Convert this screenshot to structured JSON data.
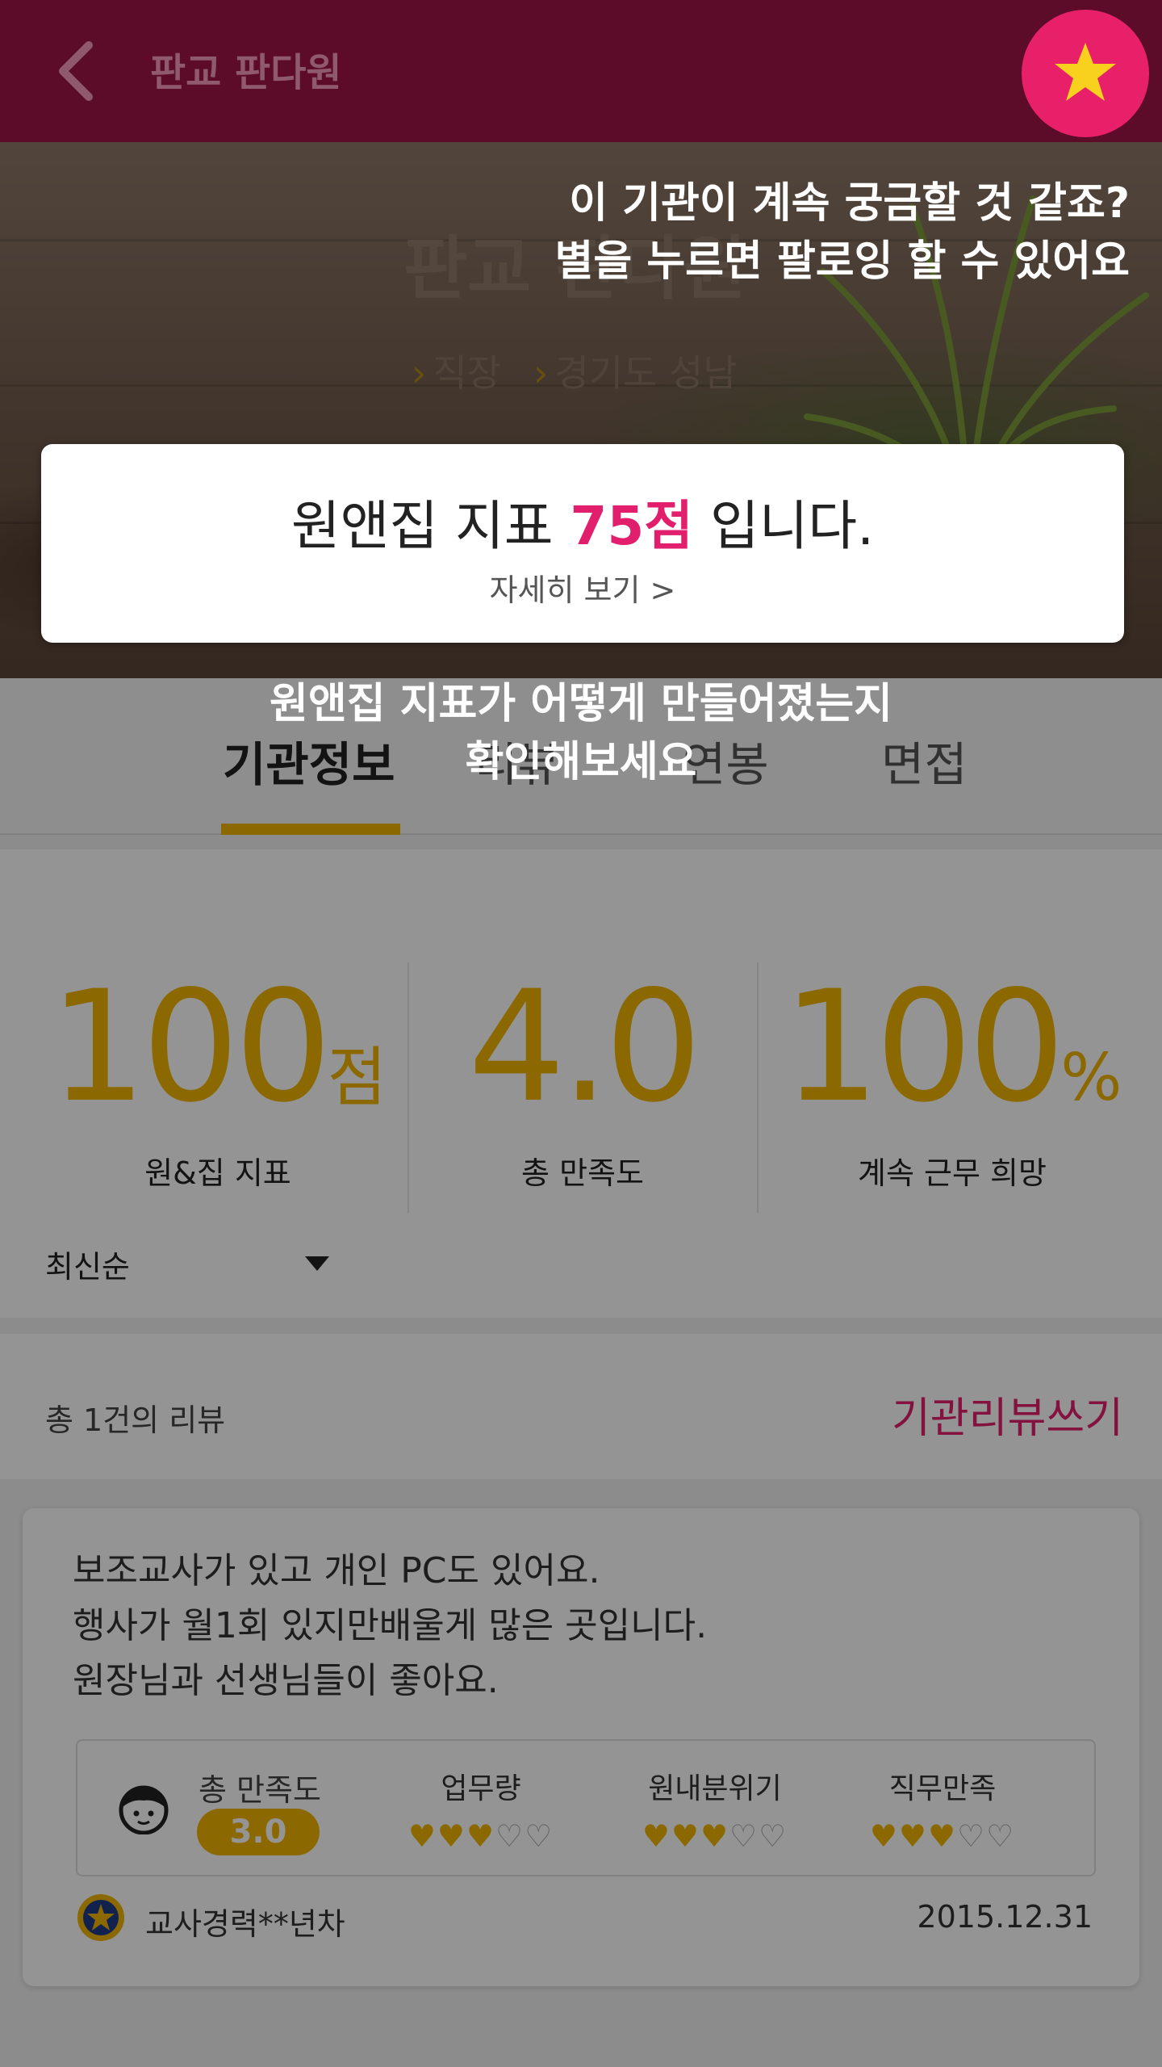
{
  "appbar": {
    "title": "판교 판다원"
  },
  "hero": {
    "title": "판교 판다원",
    "tags": [
      "직장",
      "경기도 성남"
    ]
  },
  "score_card": {
    "prefix": "원앤집 지표 ",
    "score": "75점",
    "suffix": " 입니다.",
    "link": "자세히 보기 >"
  },
  "tabs": [
    "기관정보",
    "리뷰",
    "연봉",
    "면접"
  ],
  "stats": [
    {
      "value": "100",
      "unit": "점",
      "label": "원&집 지표"
    },
    {
      "value": "4.0",
      "unit": "",
      "label": "총 만족도"
    },
    {
      "value": "100",
      "unit": "%",
      "label": "계속 근무 희망"
    }
  ],
  "sort": {
    "label": "최신순"
  },
  "reviews_header": {
    "count": "총 1건의 리뷰",
    "write": "기관리뷰쓰기"
  },
  "review": {
    "lines": [
      "보조교사가 있고 개인 PC도 있어요.",
      "행사가 월1회 있지만배울게 많은 곳입니다.",
      "원장님과 선생님들이 좋아요."
    ],
    "overall_label": "총 만족도",
    "overall_value": "3.0",
    "categories": [
      {
        "label": "업무량",
        "rating": 3,
        "max": 5
      },
      {
        "label": "원내분위기",
        "rating": 3,
        "max": 5
      },
      {
        "label": "직무만족",
        "rating": 3,
        "max": 5
      }
    ],
    "author": "교사경력**년차",
    "date": "2015.12.31"
  },
  "coachmarks": {
    "follow_line1": "이 기관이 계속 궁금할 것 같죠?",
    "follow_line2": "별을 누르면 팔로잉 할 수 있어요",
    "index_line1": "원앤집 지표가 어떻게 만들어졌는지",
    "index_line2": "확인해보세요"
  },
  "colors": {
    "brand": "#5c0b28",
    "accent": "#e21f6c",
    "gold": "#f0b400"
  },
  "icons": [
    "back-icon",
    "star-icon",
    "face-icon",
    "author-badge-icon",
    "heart-icon",
    "chevron-right-icon",
    "caret-down-icon"
  ]
}
